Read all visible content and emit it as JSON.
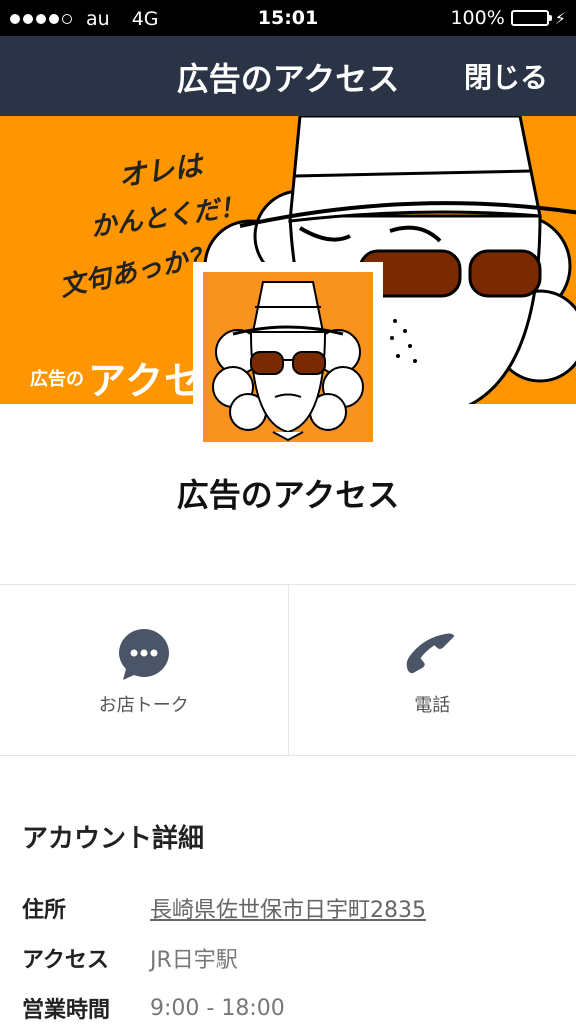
{
  "status_bar": {
    "carrier": "au",
    "network": "4G",
    "time": "15:01",
    "battery": "100%",
    "signal_bars_filled": 4,
    "signal_bars_total": 5
  },
  "nav": {
    "title": "広告のアクセス",
    "close_label": "閉じる"
  },
  "cover": {
    "handwritten_text": [
      "オレは",
      "かんとくだ！",
      "文句あっか？"
    ],
    "logo_small": "広告の",
    "logo_large": "アクセス",
    "background_color": "#ff9600"
  },
  "profile": {
    "name": "広告のアクセス"
  },
  "actions": [
    {
      "label": "お店トーク",
      "icon": "chat-bubble-icon"
    },
    {
      "label": "電話",
      "icon": "phone-icon"
    }
  ],
  "details": {
    "title": "アカウント詳細",
    "rows": [
      {
        "key": "住所",
        "value": "長崎県佐世保市日宇町2835"
      },
      {
        "key": "アクセス",
        "value": "JR日宇駅"
      },
      {
        "key": "営業時間",
        "value": "9:00 - 18:00"
      }
    ]
  }
}
